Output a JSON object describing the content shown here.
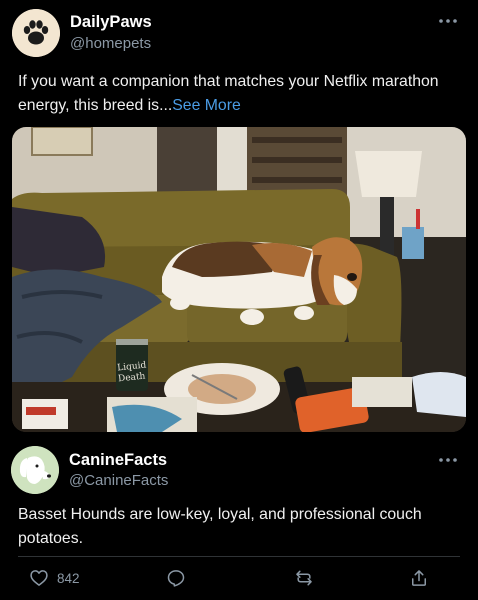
{
  "post1": {
    "author_name": "DailyPaws",
    "author_handle": "@homepets",
    "text": "If you want a companion that matches your Netflix marathon energy, this breed is...",
    "see_more": "See More",
    "media": {
      "can_text": "Liquid Death",
      "colors": {
        "sofa": "#7a6a2a",
        "wall": "#d8d2c6",
        "blanket": "#3b4656"
      }
    },
    "icons": [
      "paw-icon",
      "more-icon"
    ]
  },
  "post2": {
    "author_name": "CanineFacts",
    "author_handle": "@CanineFacts",
    "text": "Basset Hounds are low-key, loyal, and professional couch potatoes.",
    "actions": {
      "likes": "842"
    },
    "icons": [
      "dog-icon",
      "more-icon",
      "heart-icon",
      "reply-icon",
      "repost-icon",
      "share-icon"
    ]
  },
  "colors": {
    "background": "#000000",
    "link": "#4b9de6",
    "muted": "#8b98a5",
    "divider": "#2f3336"
  }
}
